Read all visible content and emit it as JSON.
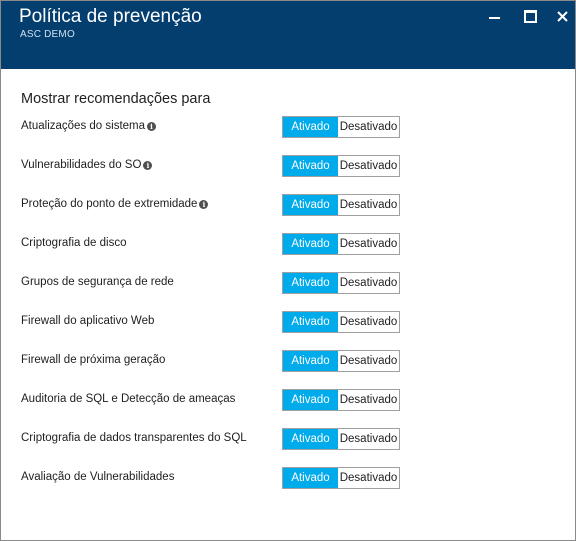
{
  "window": {
    "title": "Política de prevenção",
    "subtitle": "ASC DEMO",
    "controls": [
      "minimize-icon",
      "maximize-icon",
      "close-icon"
    ],
    "close_glyph": "✕",
    "header_color": "#033e6f"
  },
  "section": {
    "heading": "Mostrar recomendações para"
  },
  "toggle_labels": {
    "on": "Ativado",
    "off": "Desativado"
  },
  "accent_color": "#00abec",
  "info_glyph": "i",
  "rows": [
    {
      "label": "Atualizações do sistema",
      "info": true,
      "state": "Ativado"
    },
    {
      "label": "Vulnerabilidades do SO",
      "info": true,
      "state": "Ativado"
    },
    {
      "label": "Proteção do ponto de extremidade",
      "info": true,
      "state": "Ativado"
    },
    {
      "label": "Criptografia de disco",
      "info": false,
      "state": "Ativado"
    },
    {
      "label": "Grupos de segurança de rede",
      "info": false,
      "state": "Ativado"
    },
    {
      "label": "Firewall do aplicativo Web",
      "info": false,
      "state": "Ativado"
    },
    {
      "label": "Firewall de próxima geração",
      "info": false,
      "state": "Ativado"
    },
    {
      "label": "Auditoria de SQL e Detecção de ameaças",
      "info": false,
      "state": "Ativado"
    },
    {
      "label": "Criptografia de dados transparentes do SQL",
      "info": false,
      "state": "Ativado"
    },
    {
      "label": "Avaliação de Vulnerabilidades",
      "info": false,
      "state": "Ativado"
    }
  ]
}
